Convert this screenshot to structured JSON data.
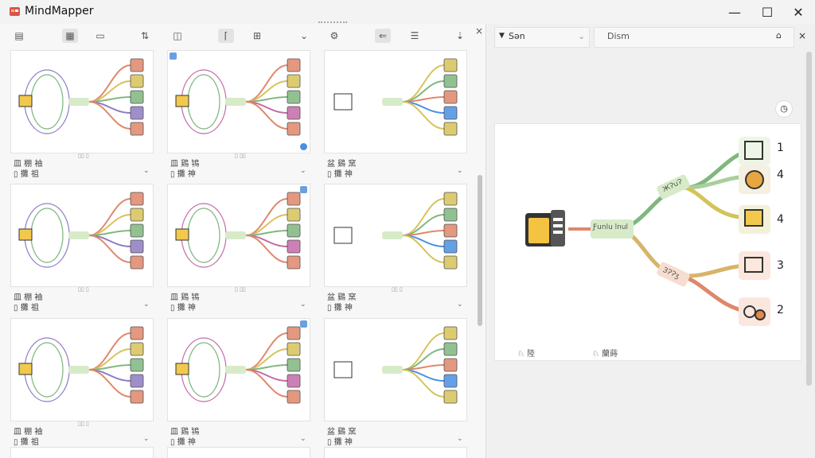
{
  "app": {
    "title": "MindMapper"
  },
  "window_controls": {
    "minimize": "—",
    "maximize": "☐",
    "close": "✕"
  },
  "left_toolbar": {
    "close": "×",
    "chevron": "⌄"
  },
  "thumbnails": [
    {
      "caption_top": "皿 棚 袖",
      "caption_bot": "▯ 攤 祖",
      "tiny": "▯▯ ▯"
    },
    {
      "caption_top": "皿 鶏 鴇",
      "caption_bot": "▯ 攤 神",
      "tiny": "▯ ▯▯"
    },
    {
      "caption_top": "盆 鷄 窯",
      "caption_bot": "▯ 攤 神",
      "tiny": ""
    },
    {
      "caption_top": "皿 棚 袖",
      "caption_bot": "▯ 攤 祖",
      "tiny": "▯▯ ▯"
    },
    {
      "caption_top": "皿 鶏 鴇",
      "caption_bot": "▯ 攤 神",
      "tiny": "▯ ▯▯"
    },
    {
      "caption_top": "盆 鷄 窯",
      "caption_bot": "▯ 攤 神",
      "tiny": "▯▯ ▯"
    },
    {
      "caption_top": "皿 棚 袖",
      "caption_bot": "▯ 攤 祖",
      "tiny": "▯▯ ▯"
    },
    {
      "caption_top": "皿 鶏 鴇",
      "caption_bot": "▯ 攤 神",
      "tiny": ""
    },
    {
      "caption_top": "盆 鷄 窯",
      "caption_bot": "▯ 攤 神",
      "tiny": ""
    }
  ],
  "right_panel": {
    "dropdown_label": "Sən",
    "field_label": "Dism",
    "close": "×",
    "clock_icon": "clock-icon",
    "preview": {
      "center_label": "Ƒunlu lnul",
      "branch_top": "ЖɁuɁ",
      "branch_bottom": "ЗɁɁʒ",
      "leaves": [
        "1",
        "4",
        "4",
        "3",
        "2"
      ],
      "footer_left": "♘ 陸",
      "footer_mid": "♘ 蘭蒔"
    }
  },
  "colors": {
    "accent_blue": "#4a90e2",
    "branch_green": "#7fb77e",
    "branch_orange": "#e0876a",
    "branch_yellow": "#d8c25a"
  }
}
